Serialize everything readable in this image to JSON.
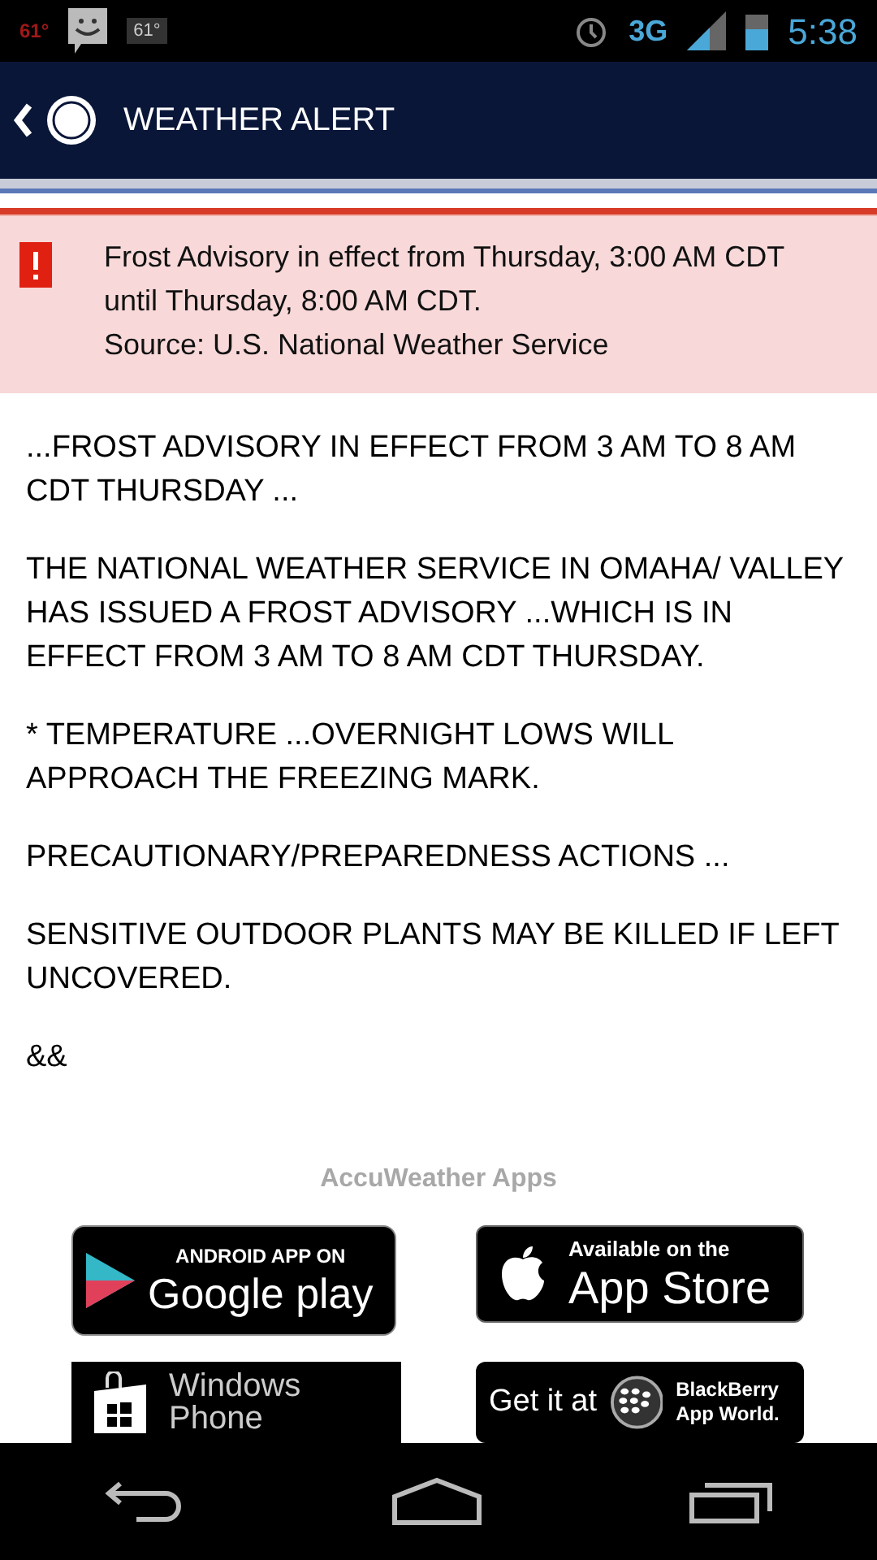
{
  "status_bar": {
    "left": [
      "61°",
      "61°"
    ],
    "network": "3G",
    "time": "5:38"
  },
  "header": {
    "title": "WEATHER ALERT"
  },
  "alert": {
    "lines": [
      "Frost Advisory in effect from Thursday, 3:00 AM CDT until Thursday, 8:00 AM CDT.",
      "Source: U.S. National Weather Service"
    ]
  },
  "paragraphs": [
    "...FROST ADVISORY IN EFFECT FROM 3 AM TO 8 AM CDT THURSDAY ...",
    "THE NATIONAL WEATHER SERVICE IN OMAHA/ VALLEY HAS ISSUED A FROST ADVISORY ...WHICH IS IN EFFECT FROM 3 AM TO 8 AM CDT THURSDAY.",
    "* TEMPERATURE ...OVERNIGHT LOWS WILL APPROACH THE FREEZING MARK.",
    "PRECAUTIONARY/PREPAREDNESS ACTIONS ...",
    "SENSITIVE OUTDOOR PLANTS MAY BE KILLED IF LEFT UNCOVERED.",
    "&&"
  ],
  "apps": {
    "title": "AccuWeather Apps",
    "badges": [
      {
        "kind": "google",
        "small": "ANDROID APP ON",
        "large": "Google play"
      },
      {
        "kind": "apple",
        "small": "Available on the",
        "large": "App Store"
      },
      {
        "kind": "windows",
        "small": "Windows",
        "large": "Phone"
      },
      {
        "kind": "blackberry",
        "small": "Get it at",
        "large": "BlackBerry App World."
      }
    ]
  }
}
